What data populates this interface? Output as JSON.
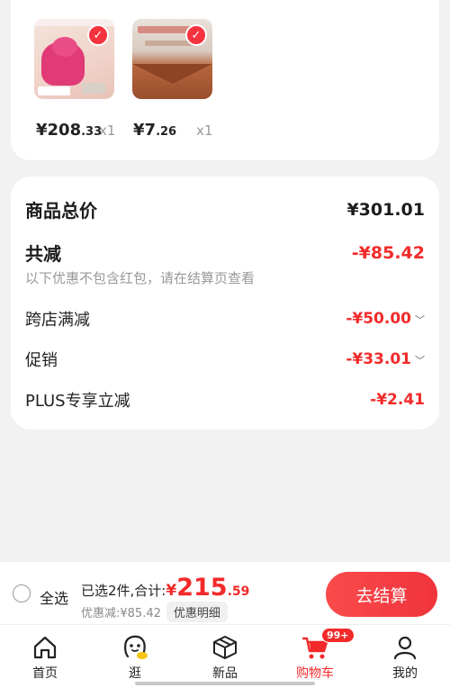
{
  "products": [
    {
      "price_int": "¥208",
      "price_dec": ".33",
      "qty": "x1"
    },
    {
      "price_int": "¥7",
      "price_dec": ".26",
      "qty": "x1"
    }
  ],
  "summary": {
    "total_label": "商品总价",
    "total_value": "¥301.01",
    "reduce_label": "共减",
    "reduce_value": "-¥85.42",
    "note": "以下优惠不包含红包，请在结算页查看",
    "items": [
      {
        "label": "跨店满减",
        "value": "-¥50.00"
      },
      {
        "label": "促销",
        "value": "-¥33.01"
      },
      {
        "label": "PLUS专享立减",
        "value": "-¥2.41"
      }
    ]
  },
  "checkout": {
    "select_all": "全选",
    "selected_text": "已选2件,合计:",
    "currency": "¥",
    "amount_int": "215",
    "amount_dec": ".59",
    "discount_text": "优惠减:¥85.42",
    "detail_label": "优惠明细",
    "checkout_label": "去结算"
  },
  "tabs": [
    {
      "label": "首页",
      "icon": "home-icon"
    },
    {
      "label": "逛",
      "icon": "browse-face-icon"
    },
    {
      "label": "新品",
      "icon": "new-box-icon"
    },
    {
      "label": "购物车",
      "icon": "cart-icon",
      "badge": "99+",
      "active": true
    },
    {
      "label": "我的",
      "icon": "profile-icon"
    }
  ],
  "colors": {
    "accent": "#f22a2a",
    "background": "#f2f2f2"
  }
}
